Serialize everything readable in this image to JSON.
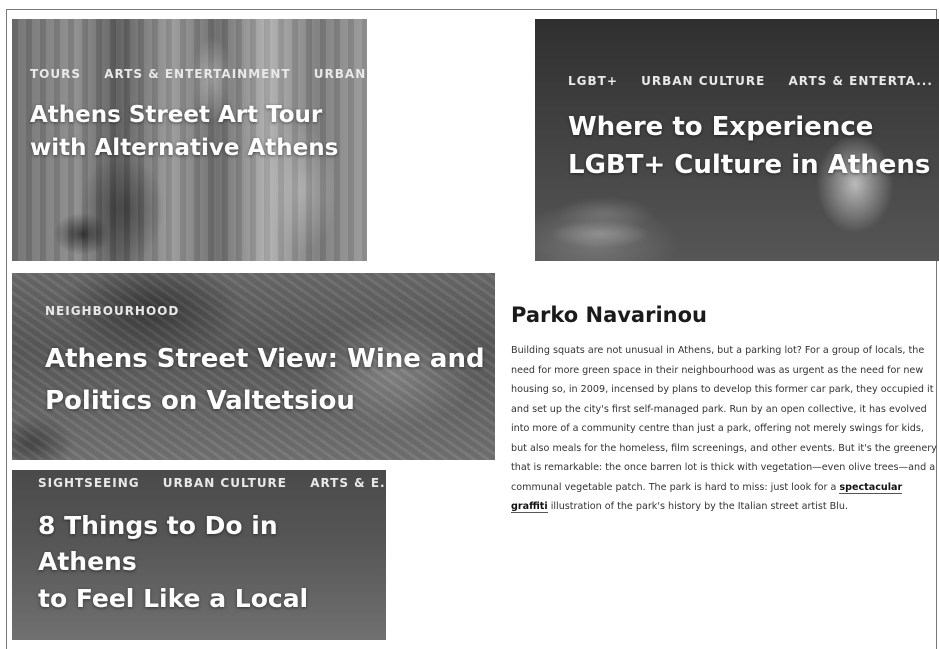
{
  "cards": [
    {
      "tags": [
        "TOURS",
        "ARTS & ENTERTAINMENT",
        "URBAN ..."
      ],
      "title_line1": "Athens Street Art Tour",
      "title_line2": "with Alternative Athens"
    },
    {
      "tags": [
        "LGBT+",
        "URBAN CULTURE",
        "ARTS & ENTERTA..."
      ],
      "title_line1": "Where to Experience",
      "title_line2": "LGBT+ Culture in Athens"
    },
    {
      "tags": [
        "NEIGHBOURHOOD"
      ],
      "title_line1": "Athens Street View: Wine and",
      "title_line2": "Politics on Valtetsiou"
    },
    {
      "tags": [
        "SIGHTSEEING",
        "URBAN CULTURE",
        "ARTS & E..."
      ],
      "title_line1": "8 Things to Do in Athens",
      "title_line2": "to Feel Like a Local"
    }
  ],
  "article": {
    "heading": "Parko Navarinou",
    "body_before_link": "Building squats are not unusual in Athens, but a parking lot? For a group of locals, the need for more green space in their neighbourhood was as urgent as the need for new housing so, in 2009, incensed by plans to develop this former car park, they occupied it and set up the city's first self-managed park. Run by an open collective, it has evolved into more of a community centre than just a park, offering not merely swings for kids, but also meals for the homeless, film screenings, and other events. But it's the greenery that is remarkable: the once barren lot is thick with vegetation—even olive trees—and a communal vegetable patch. The park is hard to miss: just look for a ",
    "link_text": "spectacular graffiti",
    "body_after_link": " illustration of the park's history by the Italian street artist Blu."
  }
}
